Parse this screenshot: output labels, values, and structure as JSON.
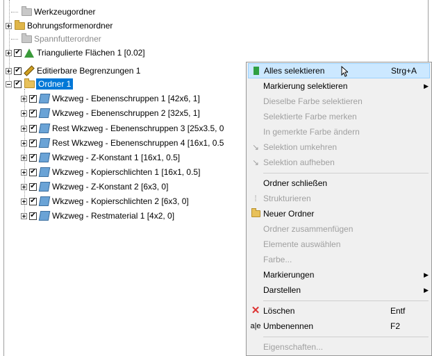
{
  "tree": {
    "items": [
      {
        "label": "Werkzeugordner",
        "state": "normal"
      },
      {
        "label": "Bohrungsformenordner",
        "state": "normal"
      },
      {
        "label": "Spannfutterordner",
        "state": "disabled"
      },
      {
        "label": "Triangulierte Flächen 1 [0.02]",
        "state": "normal"
      },
      {
        "label": "Editierbare Begrenzungen 1",
        "state": "normal"
      },
      {
        "label": "Ordner 1",
        "state": "selected"
      },
      {
        "label": "Wkzweg - Ebenenschruppen 1 [42x6, 1]",
        "state": "normal"
      },
      {
        "label": "Wkzweg - Ebenenschruppen 2 [32x5, 1]",
        "state": "normal"
      },
      {
        "label": "Rest Wkzweg - Ebenenschruppen 3 [25x3.5, 0",
        "state": "normal"
      },
      {
        "label": "Rest Wkzweg - Ebenenschruppen 4 [16x1, 0.5",
        "state": "normal"
      },
      {
        "label": "Wkzweg - Z-Konstant 1 [16x1, 0.5]",
        "state": "normal"
      },
      {
        "label": "Wkzweg - Kopierschlichten 1 [16x1, 0.5]",
        "state": "normal"
      },
      {
        "label": "Wkzweg - Z-Konstant 2 [6x3, 0]",
        "state": "normal"
      },
      {
        "label": "Wkzweg - Kopierschlichten 2 [6x3, 0]",
        "state": "normal"
      },
      {
        "label": "Wkzweg - Restmaterial 1 [4x2, 0]",
        "state": "normal"
      }
    ],
    "check_mark": "✔"
  },
  "menu": {
    "items": [
      {
        "label": "Alles selektieren",
        "shortcut": "Strg+A",
        "state": "highlight",
        "icon": "select-all-icon"
      },
      {
        "label": "Markierung selektieren",
        "submenu": "▶",
        "state": "normal"
      },
      {
        "label": "Dieselbe Farbe selektieren",
        "state": "disabled"
      },
      {
        "label": "Selektierte Farbe merken",
        "state": "disabled"
      },
      {
        "label": "In gemerkte Farbe ändern",
        "state": "disabled"
      },
      {
        "label": "Selektion umkehren",
        "state": "disabled"
      },
      {
        "label": "Selektion aufheben",
        "state": "disabled"
      },
      {
        "label": "Ordner schließen",
        "state": "normal"
      },
      {
        "label": "Strukturieren",
        "state": "disabled"
      },
      {
        "label": "Neuer Ordner",
        "state": "normal"
      },
      {
        "label": "Ordner zusammenfügen",
        "state": "disabled"
      },
      {
        "label": "Elemente auswählen",
        "state": "disabled"
      },
      {
        "label": "Farbe...",
        "state": "disabled"
      },
      {
        "label": "Markierungen",
        "submenu": "▶",
        "state": "normal"
      },
      {
        "label": "Darstellen",
        "submenu": "▶",
        "state": "normal"
      },
      {
        "label": "Löschen",
        "shortcut": "Entf",
        "state": "normal"
      },
      {
        "label": "Umbenennen",
        "shortcut": "F2",
        "state": "normal"
      },
      {
        "label": "Eigenschaften...",
        "state": "disabled"
      }
    ]
  }
}
